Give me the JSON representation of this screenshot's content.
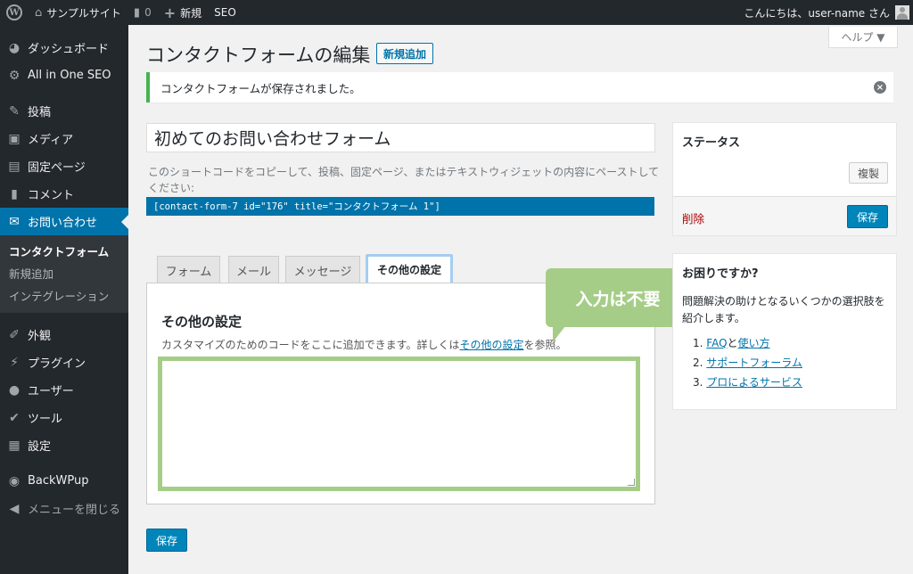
{
  "adminbar": {
    "wp_logo": "W",
    "site_name": "サンプルサイト",
    "comments_count": "0",
    "new_label": "新規",
    "seo_label": "SEO",
    "greeting": "こんにちは、user-name さん"
  },
  "sidebar": {
    "dashboard": "ダッシュボード",
    "aioseo": "All in One SEO",
    "posts": "投稿",
    "media": "メディア",
    "pages": "固定ページ",
    "comments": "コメント",
    "contact": "お問い合わせ",
    "sub_contact_forms": "コンタクトフォーム",
    "sub_add_new": "新規追加",
    "sub_integration": "インテグレーション",
    "appearance": "外観",
    "plugins": "プラグイン",
    "users": "ユーザー",
    "tools": "ツール",
    "settings": "設定",
    "backwpup": "BackWPup",
    "collapse": "メニューを閉じる"
  },
  "header": {
    "help": "ヘルプ ▼",
    "title": "コンタクトフォームの編集",
    "add_new": "新規追加"
  },
  "notice": {
    "text": "コンタクトフォームが保存されました。",
    "dismiss": "×"
  },
  "form": {
    "title": "初めてのお問い合わせフォーム",
    "shortcode_desc": "このショートコードをコピーして、投稿、固定ページ、またはテキストウィジェットの内容にペーストしてください:",
    "shortcode": "[contact-form-7 id=\"176\" title=\"コンタクトフォーム 1\"]"
  },
  "tabs": [
    {
      "label": "フォーム"
    },
    {
      "label": "メール"
    },
    {
      "label": "メッセージ"
    },
    {
      "label": "その他の設定"
    }
  ],
  "panel": {
    "heading": "その他の設定",
    "desc_before": "カスタマイズのためのコードをここに追加できます。詳しくは",
    "desc_link": "その他の設定",
    "desc_after": "を参照。",
    "textarea_value": ""
  },
  "callout": {
    "text": "入力は不要"
  },
  "save_label": "保存",
  "status_box": {
    "title": "ステータス",
    "copy": "複製",
    "delete": "削除",
    "save": "保存"
  },
  "help_box": {
    "title": "お困りですか?",
    "text": "問題解決の助けとなるいくつかの選択肢を紹介します。",
    "items": [
      {
        "num": "1.",
        "link": "FAQ",
        "sep": "と",
        "link2": "使い方"
      },
      {
        "num": "2.",
        "link": "サポートフォーラム"
      },
      {
        "num": "3.",
        "link": "プロによるサービス"
      }
    ]
  },
  "icons": {
    "home": "home-icon",
    "comment": "comment-icon",
    "plus": "plus-icon",
    "dashboard": "dashboard-icon",
    "gear": "gear-icon",
    "pin": "pin-icon",
    "media": "media-icon",
    "page": "page-icon",
    "mail": "mail-icon",
    "brush": "brush-icon",
    "plug": "plug-icon",
    "user": "user-icon",
    "wrench": "wrench-icon",
    "settings": "settings-icon"
  },
  "colors": {
    "accent": "#0073aa",
    "button": "#0085ba",
    "success": "#46b450",
    "highlight_green": "#a5cd87",
    "highlight_blue": "#a5cdf0",
    "delete": "#aa0000"
  }
}
